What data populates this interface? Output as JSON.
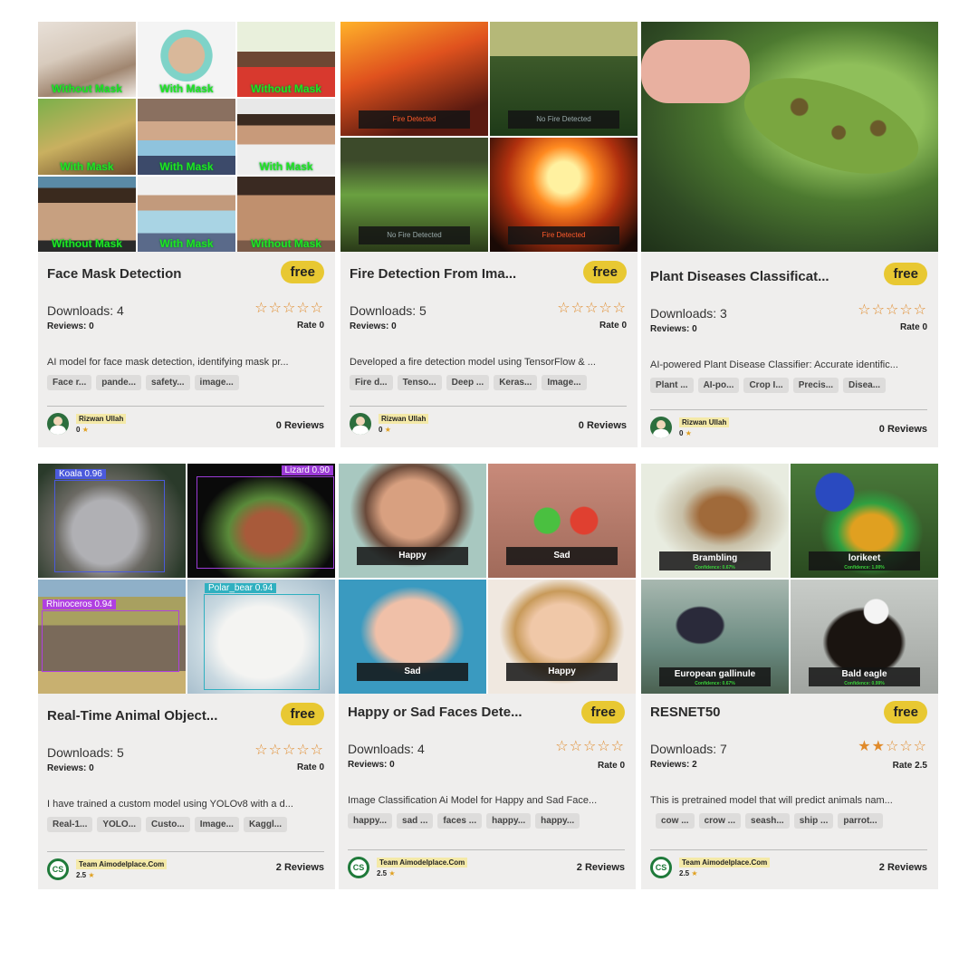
{
  "cards": [
    {
      "title": "Face Mask Detection",
      "badge": "free",
      "downloads": "Downloads: 4",
      "reviews": "Reviews: 0",
      "rate": "Rate 0",
      "rating": 0,
      "description": "AI model for face mask detection, identifying mask pr...",
      "tags": [
        "Face r...",
        "pande...",
        "safety...",
        "image..."
      ],
      "author": "Rizwan Ullah",
      "author_rating": "0",
      "reviews_count": "0 Reviews",
      "image_labels": [
        "Without Mask",
        "With Mask",
        "Without Mask",
        "With Mask",
        "With Mask",
        "With Mask",
        "Without Mask",
        "With Mask",
        "Without Mask"
      ]
    },
    {
      "title": "Fire Detection From Ima...",
      "badge": "free",
      "downloads": "Downloads: 5",
      "reviews": "Reviews: 0",
      "rate": "Rate 0",
      "rating": 0,
      "description": "Developed a fire detection model using TensorFlow & ...",
      "tags": [
        "Fire d...",
        "Tenso...",
        "Deep ...",
        "Keras...",
        "Image..."
      ],
      "author": "Rizwan Ullah",
      "author_rating": "0",
      "reviews_count": "0 Reviews",
      "image_labels": [
        "Fire Detected",
        "No Fire Detected",
        "No Fire Detected",
        "Fire Detected"
      ]
    },
    {
      "title": "Plant Diseases Classificat...",
      "badge": "free",
      "downloads": "Downloads: 3",
      "reviews": "Reviews: 0",
      "rate": "Rate 0",
      "rating": 0,
      "description": "AI-powered Plant Disease Classifier: Accurate identific...",
      "tags": [
        "Plant ...",
        "AI-po...",
        "Crop I...",
        "Precis...",
        "Disea..."
      ],
      "author": "Rizwan Ullah",
      "author_rating": "0",
      "reviews_count": "0 Reviews",
      "image_labels": []
    },
    {
      "title": "Real-Time Animal Object...",
      "badge": "free",
      "downloads": "Downloads: 5",
      "reviews": "Reviews: 0",
      "rate": "Rate 0",
      "rating": 0,
      "description": "I have trained a custom model using YOLOv8 with a d...",
      "tags": [
        "Real-1...",
        "YOLO...",
        "Custo...",
        "Image...",
        "Kaggl..."
      ],
      "author": "Team Aimodelplace.Com",
      "author_rating": "2.5",
      "reviews_count": "2 Reviews",
      "image_labels": [
        "Koala  0.96",
        "Lizard  0.90",
        "Rhinoceros  0.94",
        "Polar_bear  0.94"
      ]
    },
    {
      "title": "Happy or Sad Faces Dete...",
      "badge": "free",
      "downloads": "Downloads: 4",
      "reviews": "Reviews: 0",
      "rate": "Rate 0",
      "rating": 0,
      "description": "Image Classification Ai Model for Happy and Sad Face...",
      "tags": [
        "happy...",
        "sad ...",
        "faces ...",
        "happy...",
        "happy..."
      ],
      "author": "Team Aimodelplace.Com",
      "author_rating": "2.5",
      "reviews_count": "2 Reviews",
      "image_labels": [
        "Happy",
        "Sad",
        "Sad",
        "Happy"
      ]
    },
    {
      "title": "RESNET50",
      "badge": "free",
      "downloads": "Downloads: 7",
      "reviews": "Reviews: 2",
      "rate": "Rate 2.5",
      "rating": 2,
      "description": "This is pretrained model that will predict animals nam...",
      "tags": [
        "cow ...",
        "crow ...",
        "seash...",
        "ship ...",
        "parrot..."
      ],
      "author": "Team Aimodelplace.Com",
      "author_rating": "2.5",
      "reviews_count": "2 Reviews",
      "image_labels": [
        "Brambling",
        "lorikeet",
        "European gallinule",
        "Bald eagle"
      ],
      "image_sublabels": [
        "Confidence: 0.67%",
        "Confidence: 1.00%",
        "Confidence: 0.67%",
        "Confidence: 0.99%"
      ]
    }
  ],
  "colors": {
    "card_bg": "#efeeed",
    "badge": "#e8c832",
    "star": "#e08a2a",
    "mask_label": "#1fe81f"
  }
}
